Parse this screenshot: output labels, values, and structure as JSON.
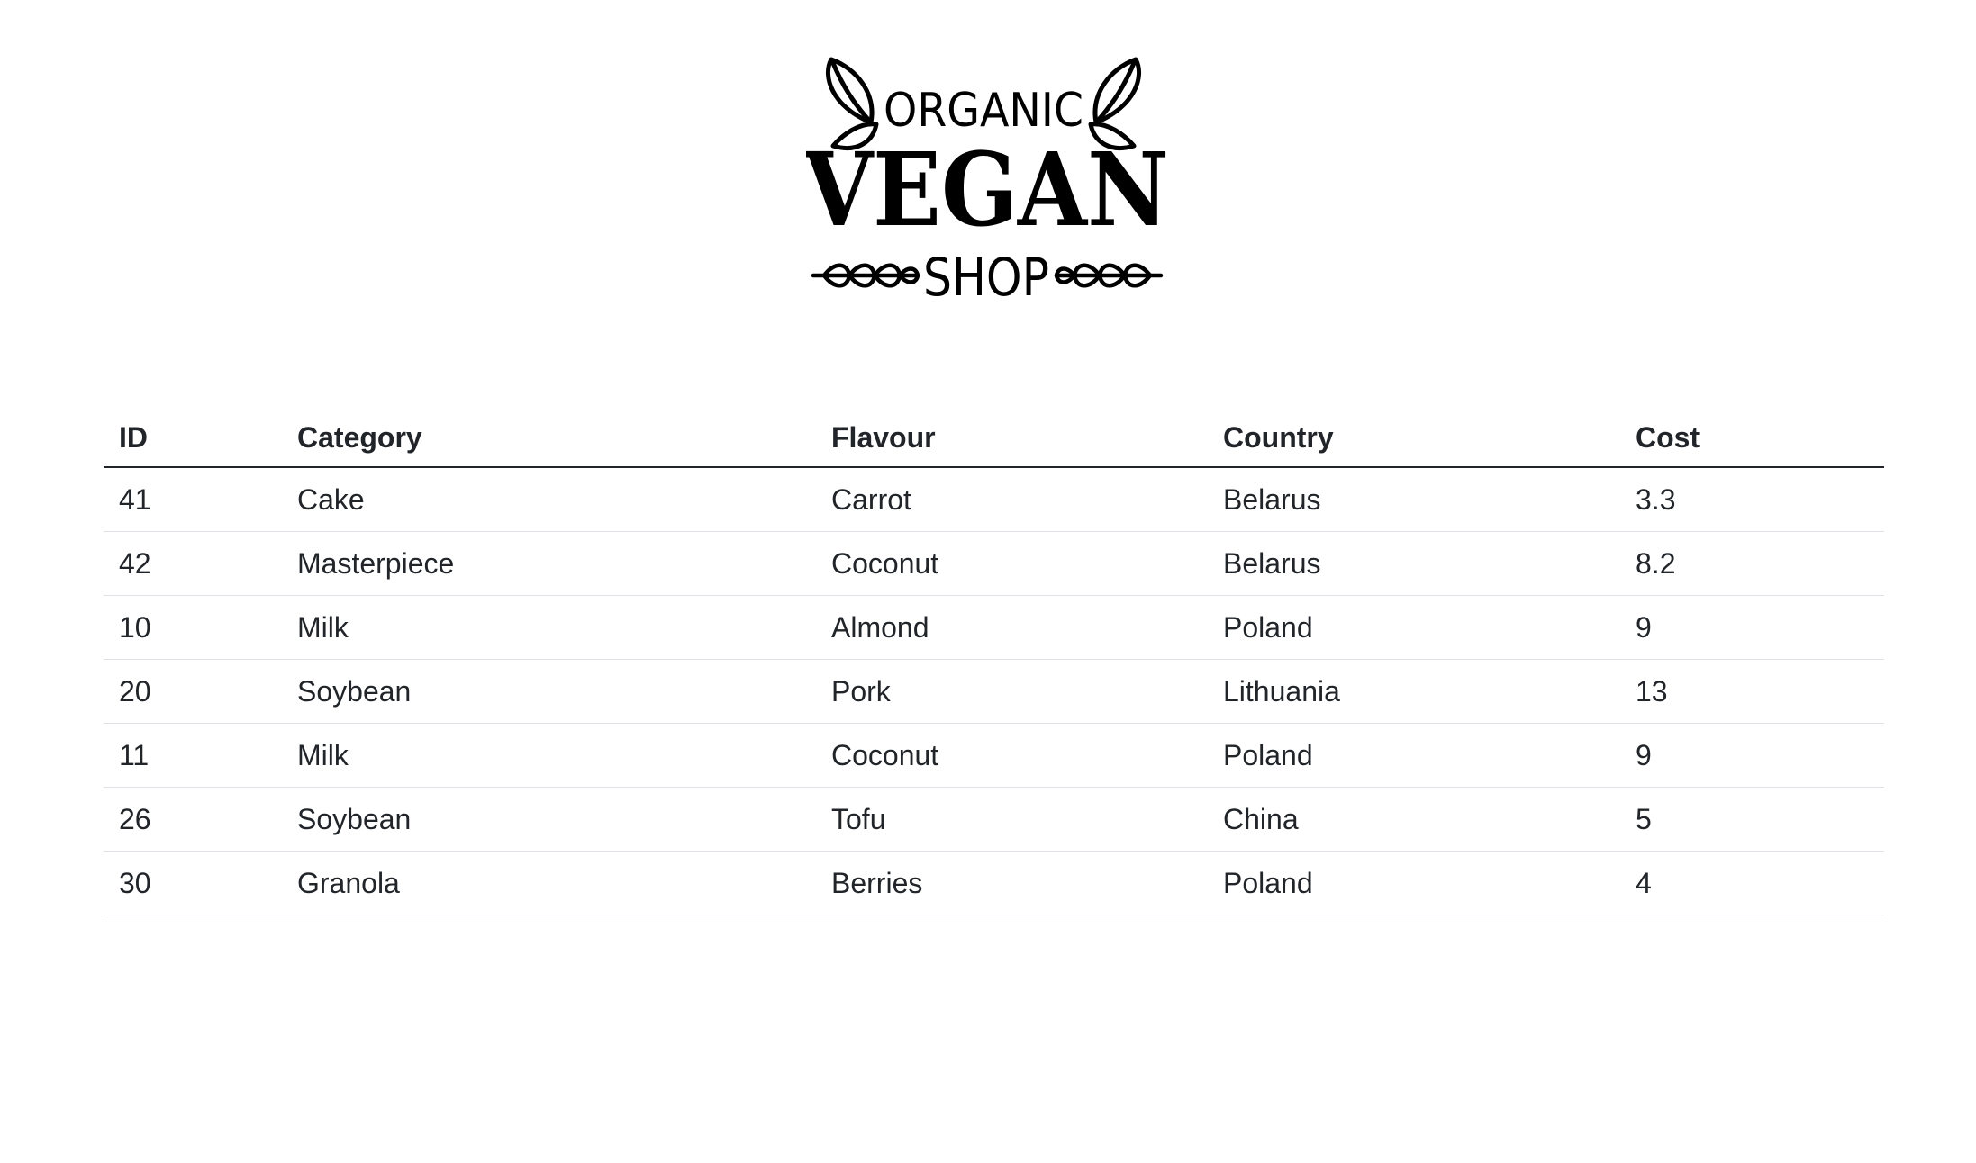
{
  "logo": {
    "line1": "ORGANIC",
    "line2": "VEGAN",
    "line3": "SHOP"
  },
  "table": {
    "headers": [
      "ID",
      "Category",
      "Flavour",
      "Country",
      "Cost"
    ],
    "rows": [
      [
        "41",
        "Cake",
        "Carrot",
        "Belarus",
        "3.3"
      ],
      [
        "42",
        "Masterpiece",
        "Coconut",
        "Belarus",
        "8.2"
      ],
      [
        "10",
        "Milk",
        "Almond",
        "Poland",
        "9"
      ],
      [
        "20",
        "Soybean",
        "Pork",
        "Lithuania",
        "13"
      ],
      [
        "11",
        "Milk",
        "Coconut",
        "Poland",
        "9"
      ],
      [
        "26",
        "Soybean",
        "Tofu",
        "China",
        "5"
      ],
      [
        "30",
        "Granola",
        "Berries",
        "Poland",
        "4"
      ]
    ]
  }
}
